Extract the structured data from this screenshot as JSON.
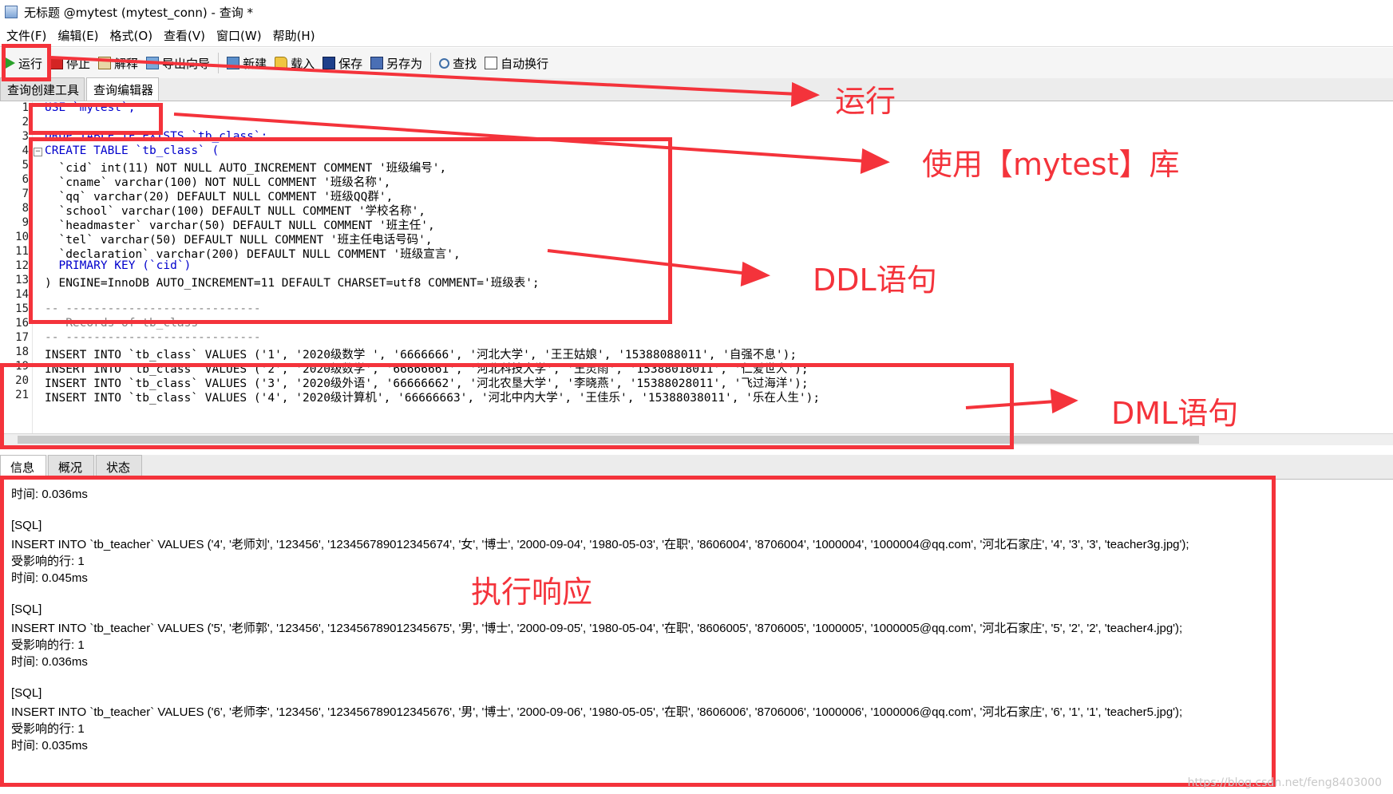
{
  "window": {
    "title": "无标题 @mytest (mytest_conn) - 查询 *"
  },
  "menu": [
    "文件(F)",
    "编辑(E)",
    "格式(O)",
    "查看(V)",
    "窗口(W)",
    "帮助(H)"
  ],
  "toolbar": {
    "run": "运行",
    "stop": "停止",
    "explain": "解释",
    "export": "导出向导",
    "new": "新建",
    "load": "载入",
    "save": "保存",
    "saveas": "另存为",
    "find": "查找",
    "wrap": "自动换行"
  },
  "editor_tabs": [
    "查询创建工具",
    "查询编辑器"
  ],
  "editor": {
    "line_numbers": [
      "1",
      "2",
      "3",
      "4",
      "5",
      "6",
      "7",
      "8",
      "9",
      "10",
      "11",
      "12",
      "13",
      "14",
      "15",
      "16",
      "17",
      "18",
      "19",
      "20",
      "21"
    ],
    "lines": [
      "USE `mytest`;",
      "",
      "DROP TABLE IF EXISTS `tb_class`;",
      "CREATE TABLE `tb_class` (",
      "  `cid` int(11) NOT NULL AUTO_INCREMENT COMMENT '班级编号',",
      "  `cname` varchar(100) NOT NULL COMMENT '班级名称',",
      "  `qq` varchar(20) DEFAULT NULL COMMENT '班级QQ群',",
      "  `school` varchar(100) DEFAULT NULL COMMENT '学校名称',",
      "  `headmaster` varchar(50) DEFAULT NULL COMMENT '班主任',",
      "  `tel` varchar(50) DEFAULT NULL COMMENT '班主任电话号码',",
      "  `declaration` varchar(200) DEFAULT NULL COMMENT '班级宣言',",
      "  PRIMARY KEY (`cid`)",
      ") ENGINE=InnoDB AUTO_INCREMENT=11 DEFAULT CHARSET=utf8 COMMENT='班级表';",
      "",
      "-- ----------------------------",
      "-- Records of tb_class",
      "-- ----------------------------",
      "INSERT INTO `tb_class` VALUES ('1', '2020级数学 ', '6666666', '河北大学', '王王姑娘', '15388088011', '自强不息');",
      "INSERT INTO `tb_class` VALUES ('2', '2020级数学', '66666661', '河北科技大学', '王灵雨', '15388018011', '仁爱世人');",
      "INSERT INTO `tb_class` VALUES ('3', '2020级外语', '66666662', '河北农垦大学', '李晓燕', '15388028011', '飞过海洋');",
      "INSERT INTO `tb_class` VALUES ('4', '2020级计算机', '66666663', '河北中内大学', '王佳乐', '15388038011', '乐在人生');"
    ]
  },
  "result_tabs": [
    "信息",
    "概况",
    "状态"
  ],
  "results": [
    "时间: 0.036ms",
    "",
    "[SQL]",
    "INSERT INTO `tb_teacher` VALUES ('4', '老师刘', '123456', '123456789012345674', '女', '博士', '2000-09-04', '1980-05-03', '在职', '8606004', '8706004', '1000004', '1000004@qq.com', '河北石家庄', '4', '3', '3', 'teacher3g.jpg');",
    "受影响的行: 1",
    "时间: 0.045ms",
    "",
    "[SQL]",
    "INSERT INTO `tb_teacher` VALUES ('5', '老师郭', '123456', '123456789012345675', '男', '博士', '2000-09-05', '1980-05-04', '在职', '8606005', '8706005', '1000005', '1000005@qq.com', '河北石家庄', '5', '2', '2', 'teacher4.jpg');",
    "受影响的行: 1",
    "时间: 0.036ms",
    "",
    "[SQL]",
    "INSERT INTO `tb_teacher` VALUES ('6', '老师李', '123456', '123456789012345676', '男', '博士', '2000-09-06', '1980-05-05', '在职', '8606006', '8706006', '1000006', '1000006@qq.com', '河北石家庄', '6', '1', '1', 'teacher5.jpg');",
    "受影响的行: 1",
    "时间: 0.035ms"
  ],
  "annotations": {
    "run": "运行",
    "use_db": "使用【mytest】库",
    "ddl": "DDL语句",
    "dml": "DML语句",
    "response": "执行响应"
  },
  "watermark": "https://blog.csdn.net/feng8403000",
  "colors": {
    "annotation": "#f4333b",
    "keyword": "#0000cc",
    "string": "#800000",
    "comment": "#808080"
  }
}
